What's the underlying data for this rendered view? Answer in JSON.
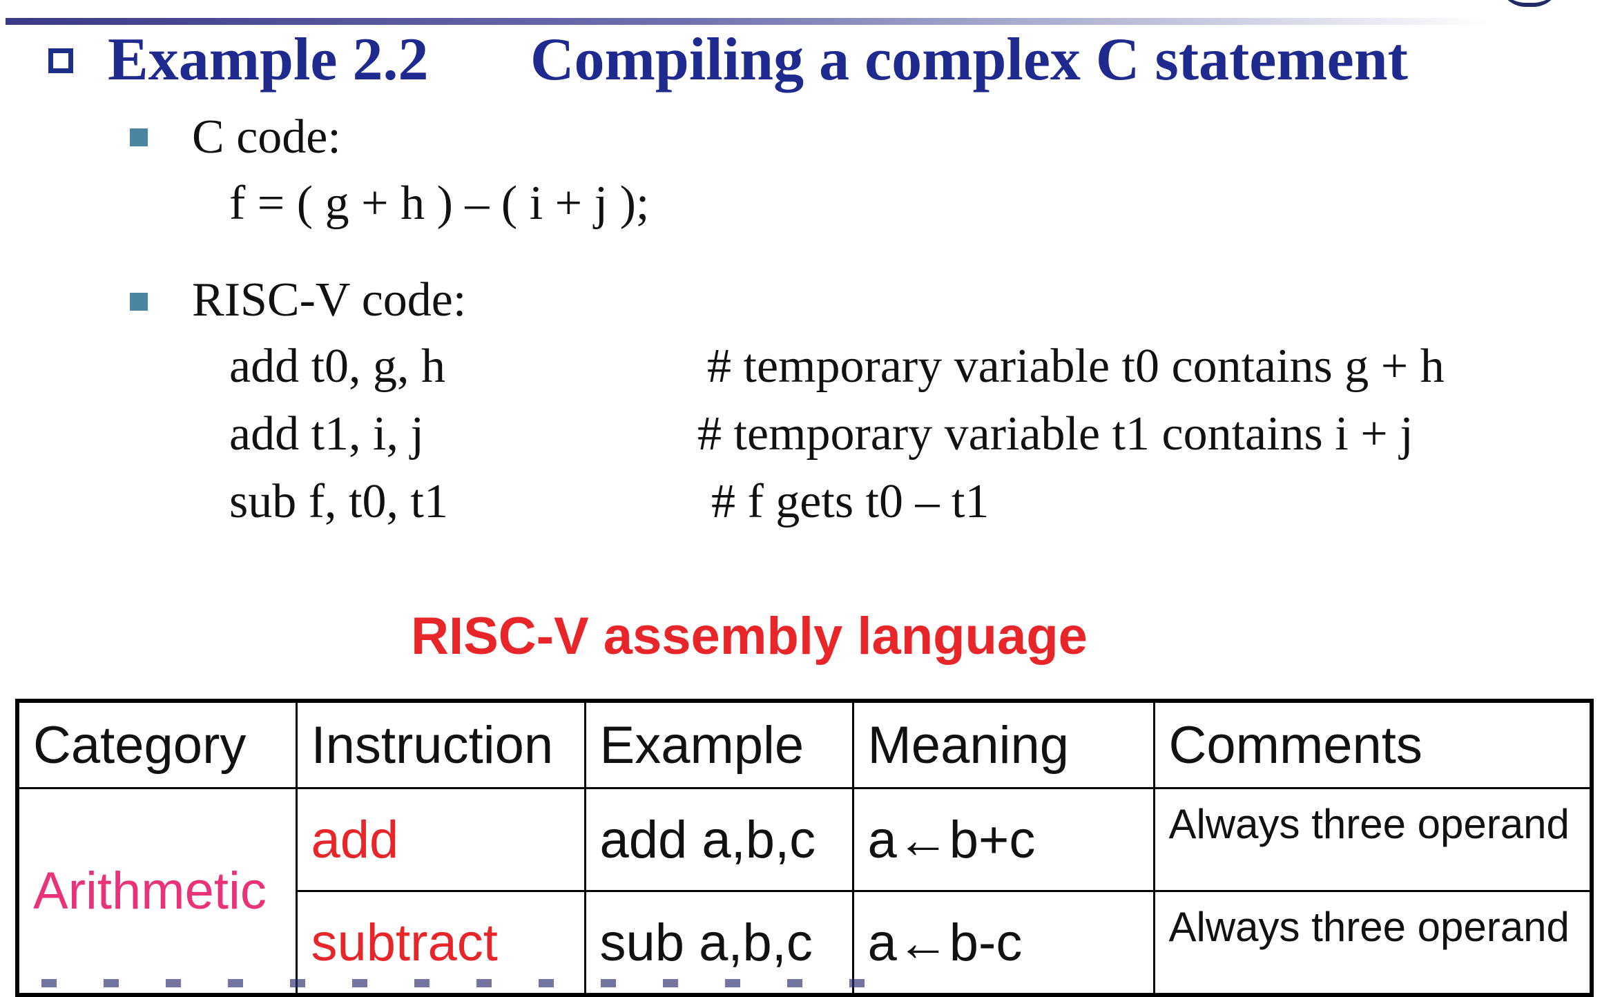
{
  "title": {
    "example": "Example 2.2",
    "topic": "Compiling a complex C statement"
  },
  "c_section": {
    "label": "C code:",
    "code": "f = ( g + h ) – ( i + j );"
  },
  "riscv_section": {
    "label": "RISC-V code:",
    "lines": [
      {
        "instr": "add  t0, g, h",
        "comment": "# temporary variable t0 contains g + h"
      },
      {
        "instr": "add  t1, i, j",
        "comment": "# temporary variable t1 contains i + j"
      },
      {
        "instr": "sub  f, t0, t1",
        "comment": "# f gets t0 – t1"
      }
    ]
  },
  "table_heading": "RISC-V assembly language",
  "table": {
    "headers": [
      "Category",
      "Instruction",
      "Example",
      "Meaning",
      "Comments"
    ],
    "category": "Arithmetic",
    "rows": [
      {
        "instruction": "add",
        "example": "add a,b,c",
        "meaning": "a←b+c",
        "comments": "Always three operand"
      },
      {
        "instruction": "subtract",
        "example": "sub a,b,c",
        "meaning": "a←b-c",
        "comments": "Always three operand"
      }
    ]
  },
  "colors": {
    "title": "#1e2a8e",
    "bullet": "#4b86a0",
    "heading": "#e8262a",
    "category": "#e8327a"
  }
}
